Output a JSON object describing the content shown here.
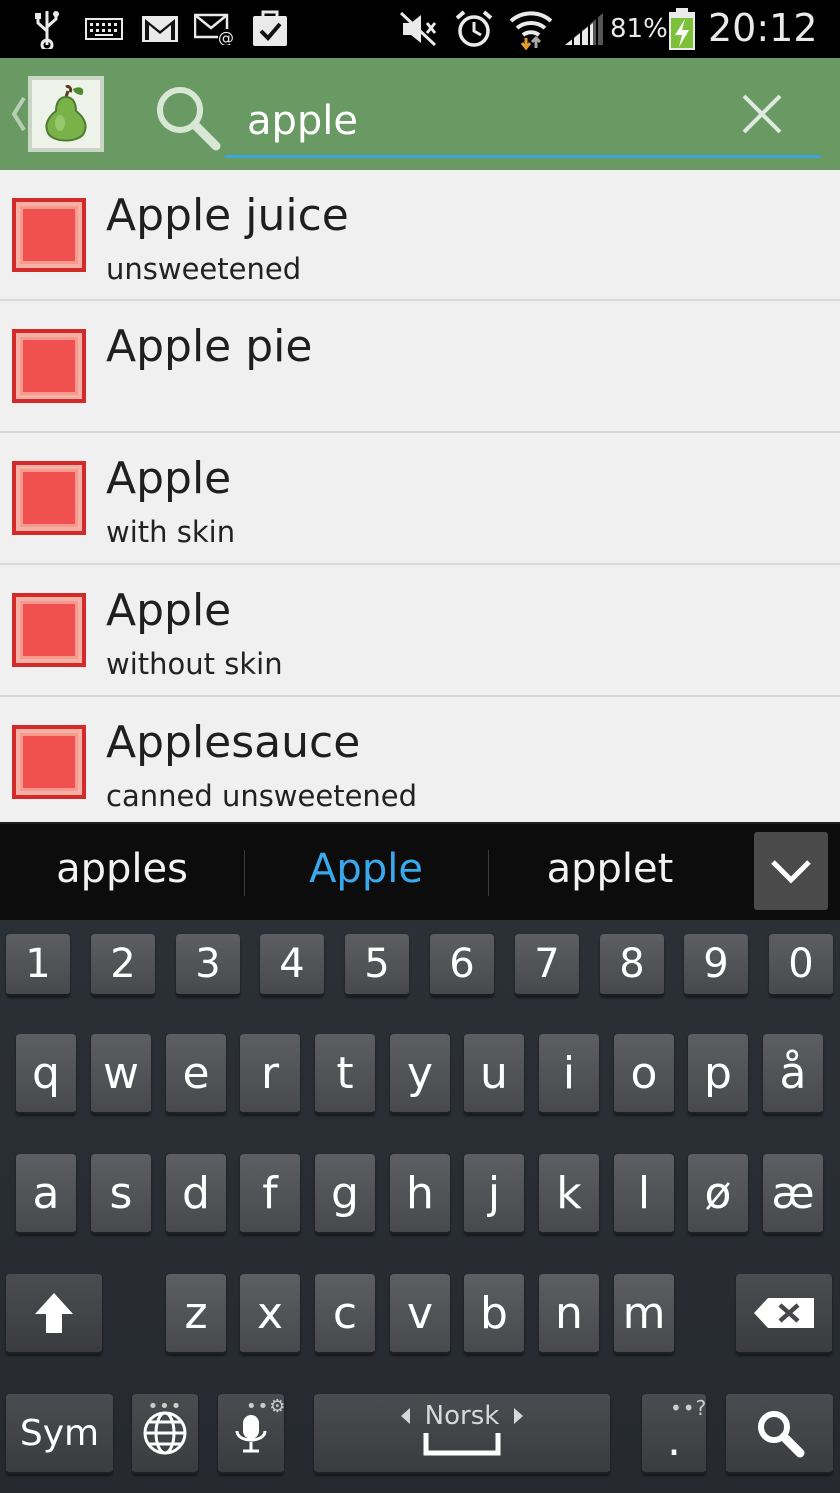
{
  "status_bar": {
    "battery": "81%",
    "time": "20:12",
    "icons": [
      "usb-icon",
      "keyboard-icon",
      "gmail-icon",
      "email-icon",
      "tasks-icon",
      "mute-icon",
      "alarm-icon",
      "wifi-icon",
      "signal-icon",
      "battery-charging-icon"
    ]
  },
  "action_bar": {
    "logo": "pear-logo-icon",
    "search_value": "apple",
    "search_icon": "search-icon",
    "clear_icon": "close-icon"
  },
  "results": [
    {
      "title": "Apple juice",
      "subtitle": "unsweetened"
    },
    {
      "title": "Apple pie",
      "subtitle": ""
    },
    {
      "title": "Apple",
      "subtitle": "with skin"
    },
    {
      "title": "Apple",
      "subtitle": "without skin"
    },
    {
      "title": "Applesauce",
      "subtitle": "canned unsweetened"
    }
  ],
  "suggestions": [
    "apples",
    "Apple",
    "applet"
  ],
  "keyboard": {
    "numbers": [
      "1",
      "2",
      "3",
      "4",
      "5",
      "6",
      "7",
      "8",
      "9",
      "0"
    ],
    "row1": [
      "q",
      "w",
      "e",
      "r",
      "t",
      "y",
      "u",
      "i",
      "o",
      "p",
      "å"
    ],
    "row2": [
      "a",
      "s",
      "d",
      "f",
      "g",
      "h",
      "j",
      "k",
      "l",
      "ø",
      "æ"
    ],
    "row3": [
      "z",
      "x",
      "c",
      "v",
      "b",
      "n",
      "m"
    ],
    "sym_label": "Sym",
    "language": "Norsk",
    "period": ".",
    "period_extra": "?"
  },
  "colors": {
    "action_bar": "#6a9a64",
    "accent": "#3aa6d8",
    "item_swatch": "#f05050"
  }
}
